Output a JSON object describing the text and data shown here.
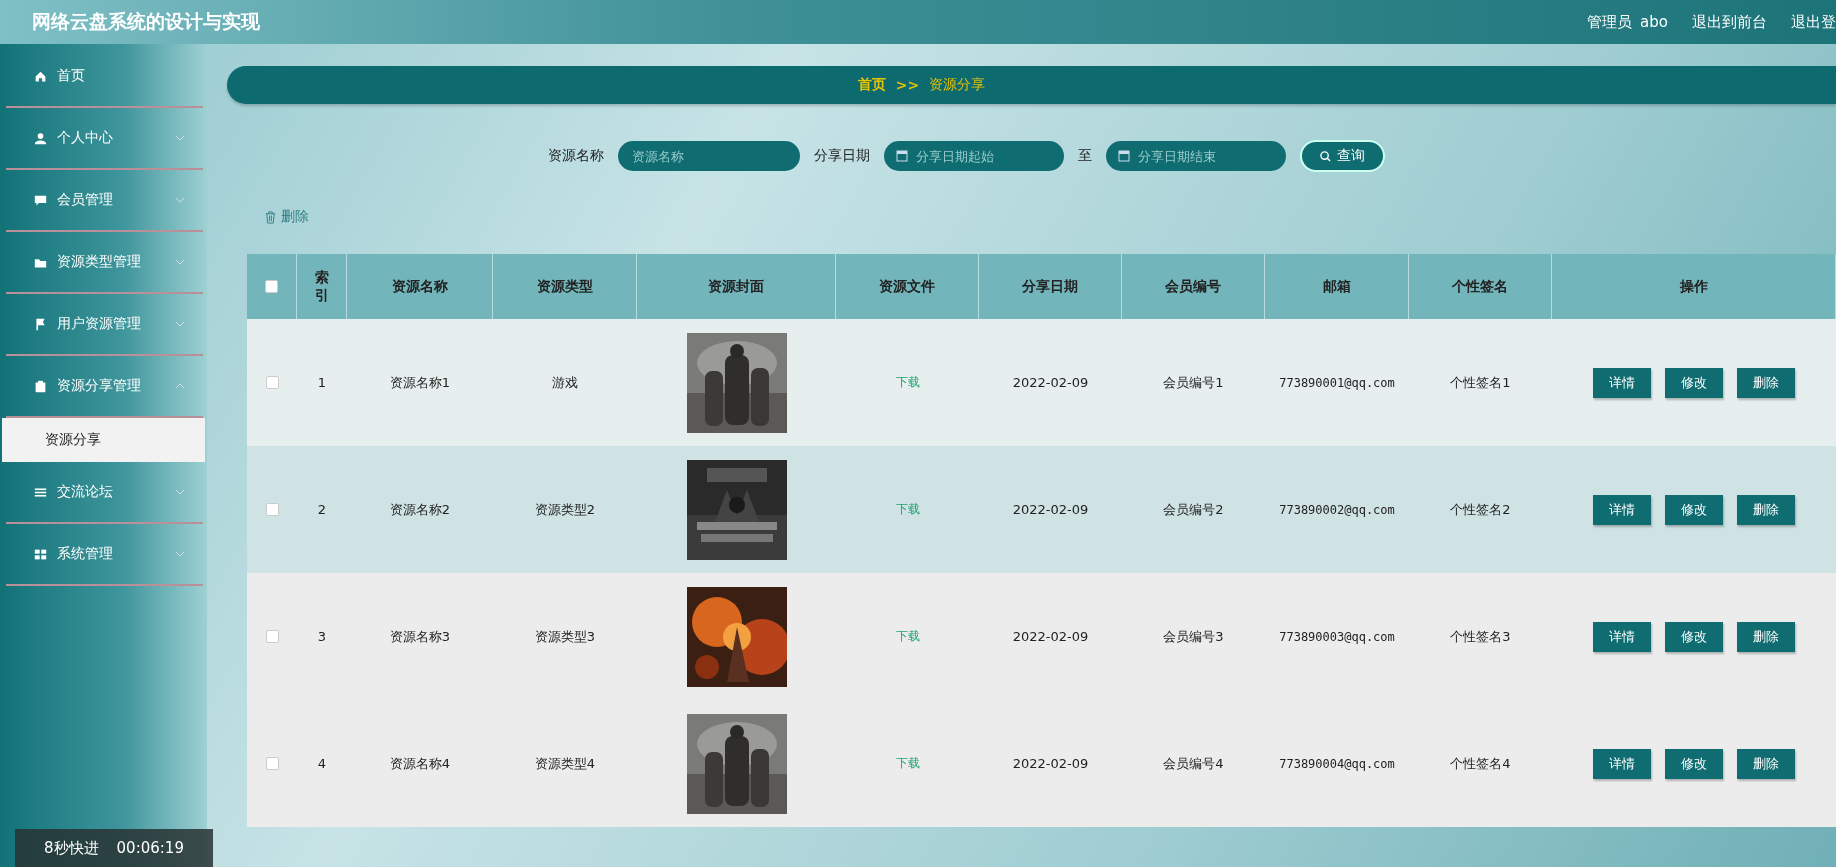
{
  "header": {
    "title": "网络云盘系统的设计与实现",
    "user_role": "管理员",
    "user_name": "abo",
    "links": [
      "退出到前台",
      "退出登"
    ]
  },
  "sidebar": {
    "items": [
      {
        "label": "首页"
      },
      {
        "label": "个人中心",
        "expanded": false
      },
      {
        "label": "会员管理",
        "expanded": false
      },
      {
        "label": "资源类型管理",
        "expanded": false
      },
      {
        "label": "用户资源管理",
        "expanded": false
      },
      {
        "label": "资源分享管理",
        "expanded": true,
        "children": [
          {
            "label": "资源分享",
            "selected": true
          }
        ]
      },
      {
        "label": "交流论坛",
        "expanded": false
      },
      {
        "label": "系统管理",
        "expanded": false
      }
    ]
  },
  "breadcrumb": {
    "home": "首页",
    "separator": ">>",
    "current": "资源分享"
  },
  "search": {
    "name_label": "资源名称",
    "name_placeholder": "资源名称",
    "date_label": "分享日期",
    "date_start_placeholder": "分享日期起始",
    "date_to": "至",
    "date_end_placeholder": "分享日期结束",
    "button": "查询"
  },
  "delete_button": "删除",
  "table": {
    "header_checked": false,
    "columns": [
      "索引",
      "资源名称",
      "资源类型",
      "资源封面",
      "资源文件",
      "分享日期",
      "会员编号",
      "邮箱",
      "个性签名",
      "操作"
    ],
    "rows": [
      {
        "checked": false,
        "index": "1",
        "name": "资源名称1",
        "type": "游戏",
        "cover": {
          "kind": "picture"
        },
        "file": "下载",
        "date": "2022-02-09",
        "member": "会员编号1",
        "email": "773890001@qq.com",
        "signature": "个性签名1",
        "actions": [
          "详情",
          "修改",
          "删除"
        ]
      },
      {
        "checked": false,
        "index": "2",
        "name": "资源名称2",
        "type": "资源类型2",
        "cover": {
          "kind": "picture"
        },
        "file": "下载",
        "date": "2022-02-09",
        "member": "会员编号2",
        "email": "773890002@qq.com",
        "signature": "个性签名2",
        "actions": [
          "详情",
          "修改",
          "删除"
        ]
      },
      {
        "checked": false,
        "index": "3",
        "name": "资源名称3",
        "type": "资源类型3",
        "cover": {
          "kind": "picture"
        },
        "file": "下载",
        "date": "2022-02-09",
        "member": "会员编号3",
        "email": "773890003@qq.com",
        "signature": "个性签名3",
        "actions": [
          "详情",
          "修改",
          "删除"
        ]
      },
      {
        "checked": false,
        "index": "4",
        "name": "资源名称4",
        "type": "资源类型4",
        "cover": {
          "kind": "picture"
        },
        "file": "下载",
        "date": "2022-02-09",
        "member": "会员编号4",
        "email": "773890004@qq.com",
        "signature": "个性签名4",
        "actions": [
          "详情",
          "修改",
          "删除"
        ]
      }
    ]
  },
  "video_overlay": {
    "speed": "8秒快进",
    "time": "00:06:19"
  }
}
